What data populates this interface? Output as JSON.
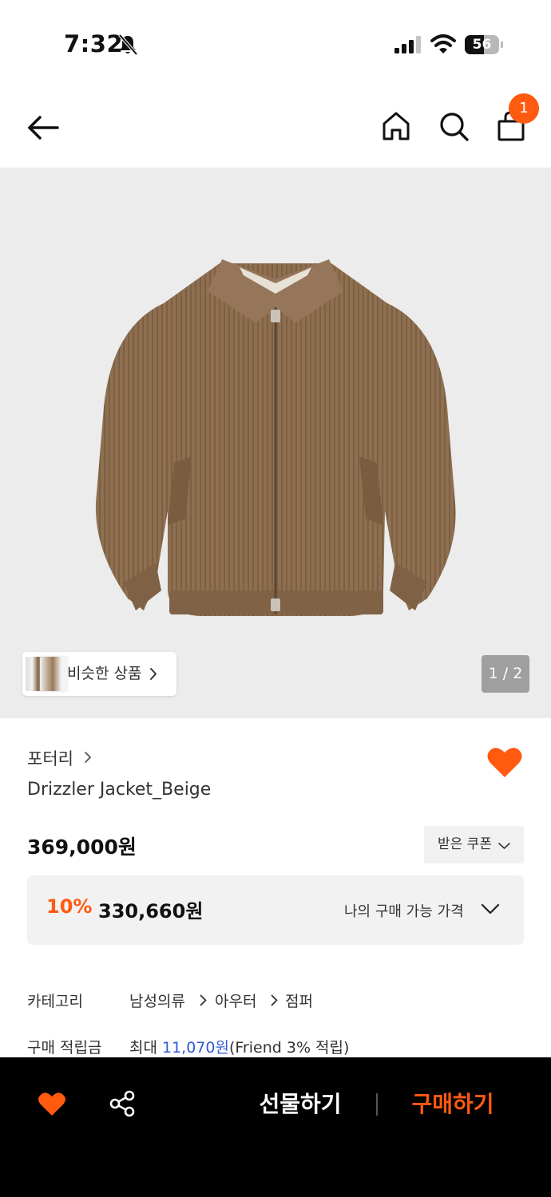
{
  "status_bar": {
    "time": "7:32",
    "battery": "56",
    "battery_level": 0.56
  },
  "header": {
    "cart_count": "1"
  },
  "gallery": {
    "similar_label": "비슷한 상품",
    "page_indicator": "1 / 2"
  },
  "product": {
    "brand": "포터리",
    "name": "Drizzler Jacket_Beige",
    "price": "369,000원",
    "coupon_label": "받은 쿠폰",
    "discount_rate": "10%",
    "discount_price": "330,660원",
    "my_price_label": "나의 구매 가능 가격"
  },
  "info": {
    "category_label": "카테고리",
    "categories": [
      "남성의류",
      "아우터",
      "점퍼"
    ],
    "points_label": "구매 적립금",
    "points_prefix": "최대 ",
    "points_amount": "11,070원",
    "points_suffix": "(Friend 3% 적립)"
  },
  "bottom_bar": {
    "gift_label": "선물하기",
    "buy_label": "구매하기"
  },
  "colors": {
    "accent": "#ff5a10",
    "link": "#2f5bd6"
  },
  "icons": [
    "bell-off-icon",
    "signal-icon",
    "wifi-icon",
    "battery-icon",
    "back-arrow-icon",
    "home-icon",
    "search-icon",
    "shopping-bag-icon",
    "chevron-right-icon",
    "heart-icon",
    "chevron-down-icon",
    "share-icon"
  ]
}
